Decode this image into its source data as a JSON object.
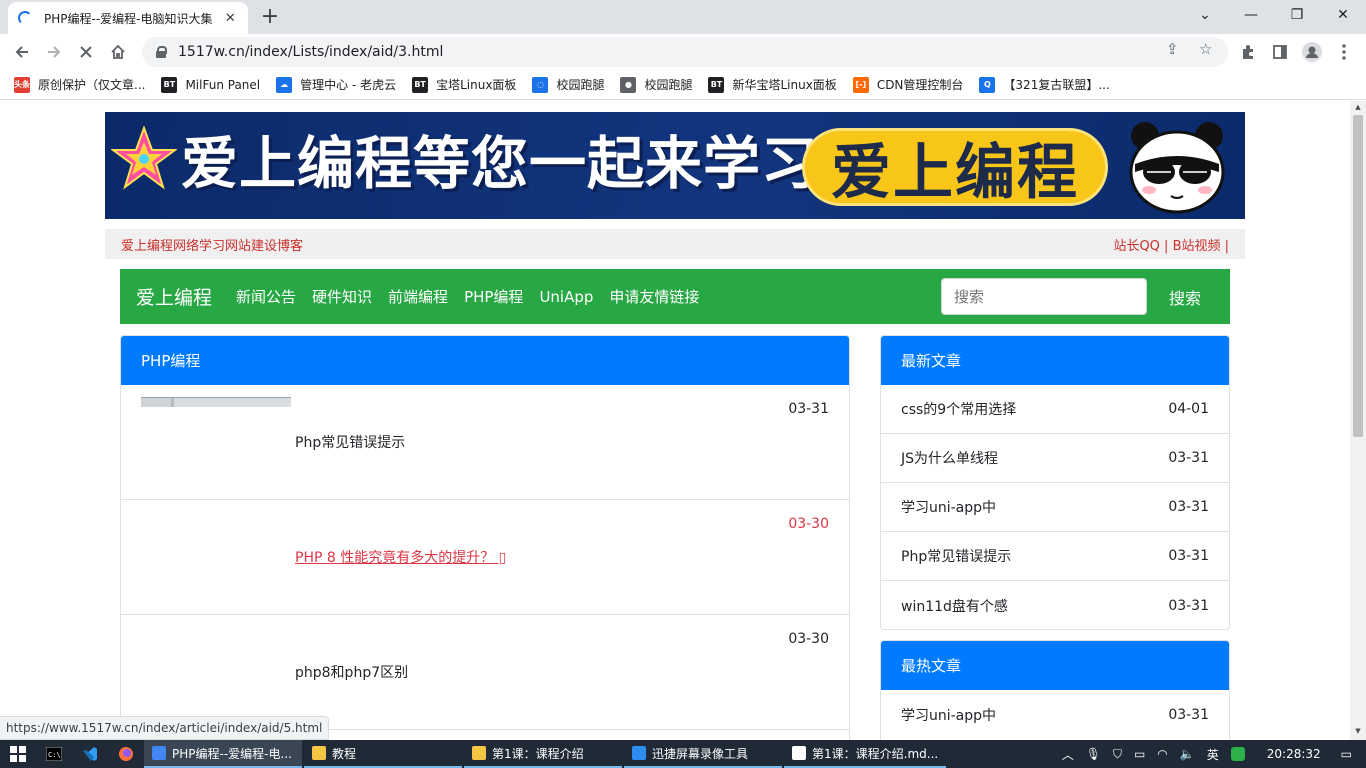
{
  "browser": {
    "tab_title": "PHP编程--爱编程-电脑知识大集",
    "tab_close": "✕",
    "new_tab": "+",
    "window_minimize": "—",
    "window_restore": "❐",
    "window_close": "✕",
    "tab_search": "⌄",
    "url": "1517w.cn/index/Lists/index/aid/3.html",
    "bookmarks": [
      {
        "label": "原创保护（仅文章...",
        "icon": "toutiao-icon",
        "icon_text": "头条",
        "color": "#e33e33"
      },
      {
        "label": "MilFun Panel",
        "icon": "bt-icon",
        "icon_text": "BT",
        "color": "#202124"
      },
      {
        "label": "管理中心 - 老虎云",
        "icon": "cloud-icon",
        "icon_text": "☁",
        "color": "#1a73e8"
      },
      {
        "label": "宝塔Linux面板",
        "icon": "bt-icon",
        "icon_text": "BT",
        "color": "#202124"
      },
      {
        "label": "校园跑腿",
        "icon": "spinner-icon",
        "icon_text": "◌",
        "color": "#1a73e8"
      },
      {
        "label": "校园跑腿",
        "icon": "globe-icon",
        "icon_text": "●",
        "color": "#5f6368"
      },
      {
        "label": "新华宝塔Linux面板",
        "icon": "bt-icon",
        "icon_text": "BT",
        "color": "#202124"
      },
      {
        "label": "CDN管理控制台",
        "icon": "aliyun-icon",
        "icon_text": "[-]",
        "color": "#ff6a00"
      },
      {
        "label": "【321复古联盟】...",
        "icon": "q-icon",
        "icon_text": "Q",
        "color": "#1a73e8"
      }
    ]
  },
  "site": {
    "banner_slogan": "爱上编程等您一起来学习",
    "banner_pill": "爱上编程",
    "banner_panda_text": "sun",
    "topbar_left": "爱上编程网络学习网站建设博客",
    "topbar_right": "站长QQ | B站视频 |",
    "brand": "爱上编程",
    "nav": [
      "新闻公告",
      "硬件知识",
      "前端编程",
      "PHP编程",
      "UniApp",
      "申请友情链接"
    ],
    "search_placeholder": "搜索",
    "search_button": "搜索",
    "list_title": "PHP编程",
    "articles": [
      {
        "date": "03-31",
        "title": "Php常见错误提示"
      },
      {
        "date": "03-30",
        "title": "PHP 8 性能究竟有多大的提升？ ▯"
      },
      {
        "date": "03-30",
        "title": "php8和php7区别"
      }
    ],
    "latest_title": "最新文章",
    "latest": [
      {
        "title": "css的9个常用选择",
        "date": "04-01"
      },
      {
        "title": "JS为什么单线程",
        "date": "03-31"
      },
      {
        "title": "学习uni-app中",
        "date": "03-31"
      },
      {
        "title": "Php常见错误提示",
        "date": "03-31"
      },
      {
        "title": "win11d盘有个感",
        "date": "03-31"
      }
    ],
    "hot_title": "最热文章",
    "hot": [
      {
        "title": "学习uni-app中",
        "date": "03-31"
      }
    ]
  },
  "status_url": "https://www.1517w.cn/index/articlei/index/aid/5.html",
  "taskbar": {
    "items": [
      {
        "label": "PHP编程--爱编程-电...",
        "color": "#4285f4",
        "active": true
      },
      {
        "label": "教程",
        "color": "#f4c542",
        "active": false
      },
      {
        "label": "第1课：课程介绍",
        "color": "#f4c542",
        "active": false
      },
      {
        "label": "迅捷屏幕录像工具",
        "color": "#2d8cf0",
        "active": false
      },
      {
        "label": "第1课：课程介绍.md...",
        "color": "#ffffff",
        "active": false
      }
    ],
    "ime": "英",
    "clock": "20:28:32"
  }
}
